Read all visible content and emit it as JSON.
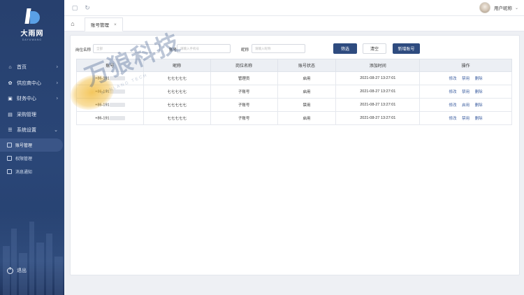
{
  "brand": {
    "name": "大雨网",
    "sub": "DAYUWANG"
  },
  "nav": {
    "items": [
      {
        "label": "首页",
        "icon": "home-icon",
        "has_arrow": true
      },
      {
        "label": "供应商中心",
        "icon": "supplier-icon",
        "has_arrow": true
      },
      {
        "label": "财务中心",
        "icon": "finance-icon",
        "has_arrow": true
      },
      {
        "label": "采购管理",
        "icon": "purchase-icon",
        "has_arrow": false
      },
      {
        "label": "系统设置",
        "icon": "settings-icon",
        "has_arrow": true
      }
    ],
    "sub_items": [
      {
        "label": "账号管理",
        "active": true
      },
      {
        "label": "权限管理",
        "active": false
      },
      {
        "label": "消息通知",
        "active": false
      }
    ],
    "logout": "退出"
  },
  "user": {
    "name": "用户昵称"
  },
  "tabs": [
    {
      "label": "账号管理"
    }
  ],
  "filter": {
    "position_label": "岗位名称",
    "position_placeholder": "全部",
    "account_label": "账号",
    "account_placeholder": "请输入手机号",
    "nickname_label": "昵称",
    "nickname_placeholder": "请输入昵称",
    "search_btn": "筛选",
    "clear_btn": "清空",
    "add_btn": "新增账号"
  },
  "table": {
    "headers": [
      "账号",
      "昵称",
      "岗位名称",
      "账号状态",
      "添加时间",
      "操作"
    ],
    "rows": [
      {
        "account": "+86-191",
        "nickname": "七七七七七",
        "position": "管理员",
        "status": "启用",
        "time": "2021-08-27  13:27:01",
        "ops": [
          "修改",
          "禁用",
          "删除"
        ]
      },
      {
        "account": "+86-191",
        "nickname": "七七七七七",
        "position": "子账号",
        "status": "启用",
        "time": "2021-08-27  13:27:01",
        "ops": [
          "修改",
          "禁用",
          "删除"
        ]
      },
      {
        "account": "+86-191",
        "nickname": "七七七七七",
        "position": "子账号",
        "status": "禁用",
        "time": "2021-08-27  13:27:01",
        "ops": [
          "修改",
          "启用",
          "删除"
        ]
      },
      {
        "account": "+86-191",
        "nickname": "七七七七七",
        "position": "子账号",
        "status": "启用",
        "time": "2021-08-27  13:27:01",
        "ops": [
          "修改",
          "禁用",
          "删除"
        ]
      }
    ]
  },
  "watermark": {
    "text": "万狼科技",
    "sub": "WANLANG TECH"
  },
  "colors": {
    "sidebar": "#27406e",
    "primary": "#2e4b7f",
    "disabled_status": "#e05a5a",
    "link": "#3c5ea0"
  }
}
